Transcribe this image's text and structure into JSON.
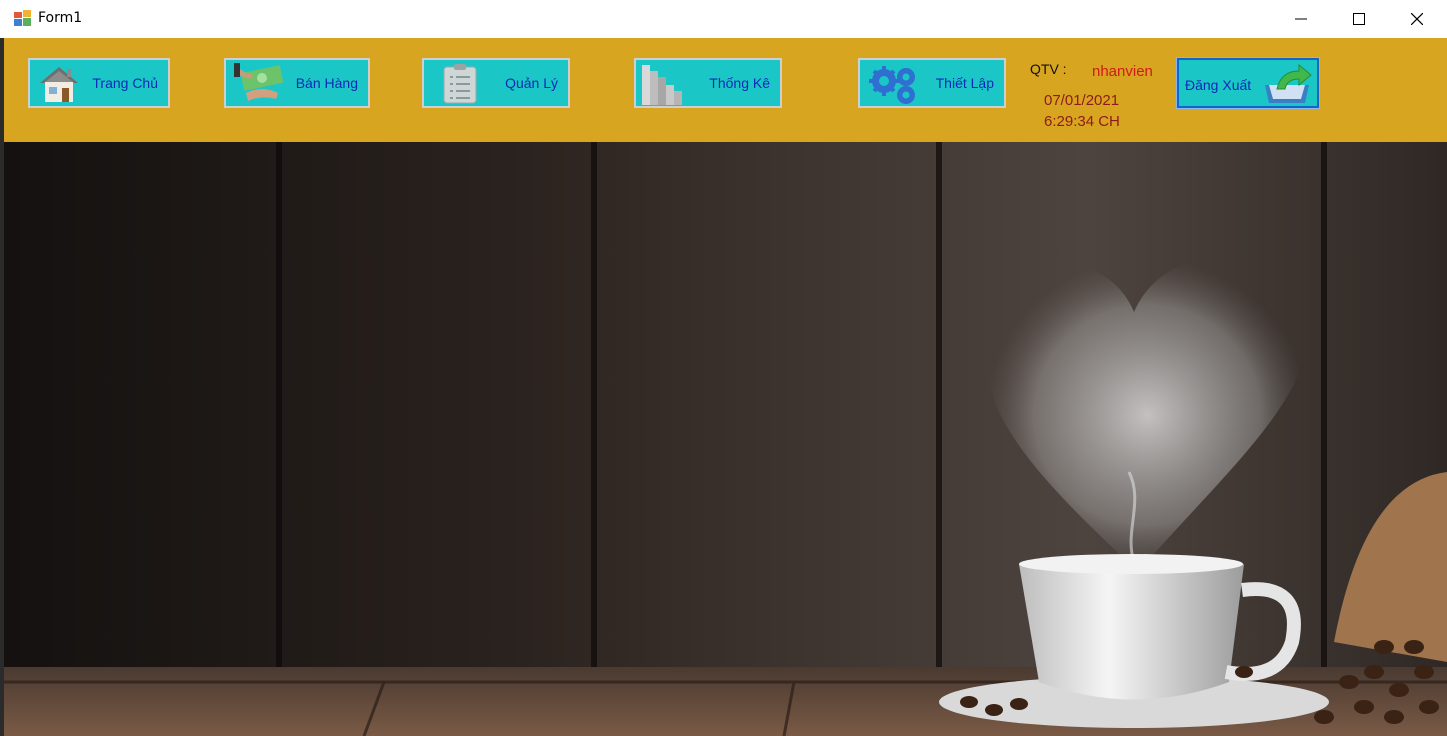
{
  "window": {
    "title": "Form1",
    "controls": [
      "minimize-icon",
      "maximize-icon",
      "close-icon"
    ]
  },
  "toolbar": {
    "nav": [
      {
        "label": "Trang Chủ",
        "icon": "house-icon"
      },
      {
        "label": "Bán Hàng",
        "icon": "money-hand-icon"
      },
      {
        "label": "Quản Lý",
        "icon": "clipboard-checklist-icon"
      },
      {
        "label": "Thống Kê",
        "icon": "bar-chart-icon"
      },
      {
        "label": "Thiết Lập",
        "icon": "gears-icon"
      }
    ],
    "qtv_label": "QTV :",
    "username": "nhanvien",
    "date": "07/01/2021",
    "time": "6:29:34 CH",
    "logout_label": "Đăng Xuất",
    "logout_icon": "logout-arrow-icon"
  },
  "colors": {
    "toolbar_bg": "#d7a520",
    "button_bg": "#1bc7c6",
    "button_text": "#102ab8",
    "username": "#d21a1a",
    "datetime": "#8e1b1b"
  },
  "hero": {
    "image": "coffee-cup-steam-heart"
  }
}
